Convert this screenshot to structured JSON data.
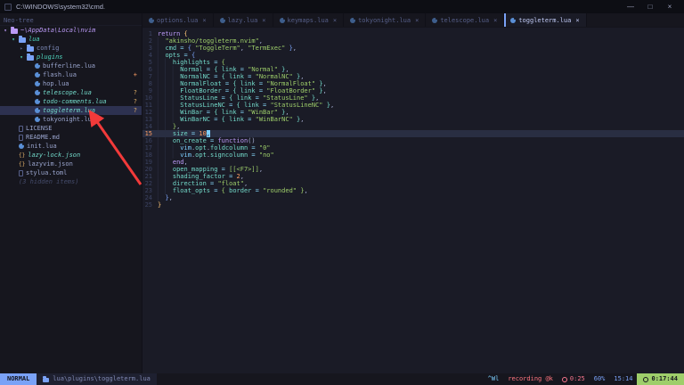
{
  "titlebar": {
    "title": "C:\\WINDOWS\\system32\\cmd.",
    "minimize": "—",
    "maximize": "□",
    "close": "×"
  },
  "sidebar": {
    "title": "Neo-tree",
    "items": [
      {
        "name": "~\\AppData\\Local\\nvim",
        "depth": 0,
        "kind": "root",
        "chevron": "▾"
      },
      {
        "name": "lua",
        "depth": 1,
        "kind": "dir-open",
        "chevron": "▾"
      },
      {
        "name": "config",
        "depth": 2,
        "kind": "dir",
        "chevron": "▸"
      },
      {
        "name": "plugins",
        "depth": 2,
        "kind": "dir-open",
        "chevron": "▾"
      },
      {
        "name": "bufferline.lua",
        "depth": 3,
        "kind": "lua-file"
      },
      {
        "name": "flash.lua",
        "depth": 3,
        "kind": "lua-file",
        "badge": "+",
        "badge_kind": "mod"
      },
      {
        "name": "hop.lua",
        "depth": 3,
        "kind": "lua-file"
      },
      {
        "name": "telescope.lua",
        "depth": 3,
        "kind": "lua-file untracked",
        "badge": "?",
        "badge_kind": "untracked"
      },
      {
        "name": "todo-comments.lua",
        "depth": 3,
        "kind": "lua-file untracked",
        "badge": "?",
        "badge_kind": "untracked"
      },
      {
        "name": "toggleterm.lua",
        "depth": 3,
        "kind": "lua-file untracked selected",
        "badge": "?",
        "badge_kind": "untracked"
      },
      {
        "name": "tokyonight.lua",
        "depth": 3,
        "kind": "lua-file"
      },
      {
        "name": "LICENSE",
        "depth": 1,
        "kind": "doc-file"
      },
      {
        "name": "README.md",
        "depth": 1,
        "kind": "doc-file"
      },
      {
        "name": "init.lua",
        "depth": 1,
        "kind": "lua-file"
      },
      {
        "name": "lazy-lock.json",
        "depth": 1,
        "kind": "json-file untracked"
      },
      {
        "name": "lazyvim.json",
        "depth": 1,
        "kind": "json-file"
      },
      {
        "name": "stylua.toml",
        "depth": 1,
        "kind": "doc-file"
      },
      {
        "name": "(3 hidden items)",
        "depth": 1,
        "kind": "hidden-note"
      }
    ]
  },
  "tabbar": {
    "close_glyph": "×",
    "tabs": [
      {
        "label": "options.lua",
        "active": false
      },
      {
        "label": "lazy.lua",
        "active": false
      },
      {
        "label": "keymaps.lua",
        "active": false
      },
      {
        "label": "tokyonight.lua",
        "active": false
      },
      {
        "label": "telescope.lua",
        "active": false
      },
      {
        "label": "toggleterm.lua",
        "active": true
      }
    ]
  },
  "editor": {
    "lines": [
      {
        "n": 1,
        "tokens": [
          [
            "k",
            "return"
          ],
          [
            "p",
            " "
          ],
          [
            "b1",
            "{"
          ]
        ]
      },
      {
        "n": 2,
        "tokens": [
          [
            "g",
            "▏ "
          ],
          [
            "s",
            "\"akinsho/toggleterm.nvim\""
          ],
          [
            "p",
            ","
          ]
        ]
      },
      {
        "n": 3,
        "tokens": [
          [
            "g",
            "▏ "
          ],
          [
            "f",
            "cmd"
          ],
          [
            "o",
            " = "
          ],
          [
            "b2",
            "{"
          ],
          [
            "p",
            " "
          ],
          [
            "s",
            "\"ToggleTerm\""
          ],
          [
            "p",
            ", "
          ],
          [
            "s",
            "\"TermExec\""
          ],
          [
            "p",
            " "
          ],
          [
            "b2",
            "}"
          ],
          [
            "p",
            ","
          ]
        ]
      },
      {
        "n": 4,
        "tokens": [
          [
            "g",
            "▏ "
          ],
          [
            "f",
            "opts"
          ],
          [
            "o",
            " = "
          ],
          [
            "b2",
            "{"
          ]
        ]
      },
      {
        "n": 5,
        "tokens": [
          [
            "g",
            "▏ ▏ "
          ],
          [
            "f",
            "highlights"
          ],
          [
            "o",
            " = "
          ],
          [
            "b3",
            "{"
          ]
        ]
      },
      {
        "n": 6,
        "tokens": [
          [
            "g",
            "▏ ▏ ▏ "
          ],
          [
            "f",
            "Normal"
          ],
          [
            "o",
            " = "
          ],
          [
            "b4",
            "{"
          ],
          [
            "p",
            " "
          ],
          [
            "f",
            "link"
          ],
          [
            "o",
            " = "
          ],
          [
            "s",
            "\"Normal\""
          ],
          [
            "p",
            " "
          ],
          [
            "b4",
            "}"
          ],
          [
            "p",
            ","
          ]
        ]
      },
      {
        "n": 7,
        "tokens": [
          [
            "g",
            "▏ ▏ ▏ "
          ],
          [
            "f",
            "NormalNC"
          ],
          [
            "o",
            " = "
          ],
          [
            "b4",
            "{"
          ],
          [
            "p",
            " "
          ],
          [
            "f",
            "link"
          ],
          [
            "o",
            " = "
          ],
          [
            "s",
            "\"NormalNC\""
          ],
          [
            "p",
            " "
          ],
          [
            "b4",
            "}"
          ],
          [
            "p",
            ","
          ]
        ]
      },
      {
        "n": 8,
        "tokens": [
          [
            "g",
            "▏ ▏ ▏ "
          ],
          [
            "f",
            "NormalFloat"
          ],
          [
            "o",
            " = "
          ],
          [
            "b4",
            "{"
          ],
          [
            "p",
            " "
          ],
          [
            "f",
            "link"
          ],
          [
            "o",
            " = "
          ],
          [
            "s",
            "\"NormalFloat\""
          ],
          [
            "p",
            " "
          ],
          [
            "b4",
            "}"
          ],
          [
            "p",
            ","
          ]
        ]
      },
      {
        "n": 9,
        "tokens": [
          [
            "g",
            "▏ ▏ ▏ "
          ],
          [
            "f",
            "FloatBorder"
          ],
          [
            "o",
            " = "
          ],
          [
            "b4",
            "{"
          ],
          [
            "p",
            " "
          ],
          [
            "f",
            "link"
          ],
          [
            "o",
            " = "
          ],
          [
            "s",
            "\"FloatBorder\""
          ],
          [
            "p",
            " "
          ],
          [
            "b4",
            "}"
          ],
          [
            "p",
            ","
          ]
        ]
      },
      {
        "n": 10,
        "tokens": [
          [
            "g",
            "▏ ▏ ▏ "
          ],
          [
            "f",
            "StatusLine"
          ],
          [
            "o",
            " = "
          ],
          [
            "b4",
            "{"
          ],
          [
            "p",
            " "
          ],
          [
            "f",
            "link"
          ],
          [
            "o",
            " = "
          ],
          [
            "s",
            "\"StatusLine\""
          ],
          [
            "p",
            " "
          ],
          [
            "b4",
            "}"
          ],
          [
            "p",
            ","
          ]
        ]
      },
      {
        "n": 11,
        "tokens": [
          [
            "g",
            "▏ ▏ ▏ "
          ],
          [
            "f",
            "StatusLineNC"
          ],
          [
            "o",
            " = "
          ],
          [
            "b4",
            "{"
          ],
          [
            "p",
            " "
          ],
          [
            "f",
            "link"
          ],
          [
            "o",
            " = "
          ],
          [
            "s",
            "\"StatusLineNC\""
          ],
          [
            "p",
            " "
          ],
          [
            "b4",
            "}"
          ],
          [
            "p",
            ","
          ]
        ]
      },
      {
        "n": 12,
        "tokens": [
          [
            "g",
            "▏ ▏ ▏ "
          ],
          [
            "f",
            "WinBar"
          ],
          [
            "o",
            " = "
          ],
          [
            "b4",
            "{"
          ],
          [
            "p",
            " "
          ],
          [
            "f",
            "link"
          ],
          [
            "o",
            " = "
          ],
          [
            "s",
            "\"WinBar\""
          ],
          [
            "p",
            " "
          ],
          [
            "b4",
            "}"
          ],
          [
            "p",
            ","
          ]
        ]
      },
      {
        "n": 13,
        "tokens": [
          [
            "g",
            "▏ ▏ ▏ "
          ],
          [
            "f",
            "WinBarNC"
          ],
          [
            "o",
            " = "
          ],
          [
            "b4",
            "{"
          ],
          [
            "p",
            " "
          ],
          [
            "f",
            "link"
          ],
          [
            "o",
            " = "
          ],
          [
            "s",
            "\"WinBarNC\""
          ],
          [
            "p",
            " "
          ],
          [
            "b4",
            "}"
          ],
          [
            "p",
            ","
          ]
        ]
      },
      {
        "n": 14,
        "tokens": [
          [
            "g",
            "▏ ▏ "
          ],
          [
            "b3",
            "}"
          ],
          [
            "p",
            ","
          ]
        ]
      },
      {
        "n": 15,
        "current": true,
        "tokens": [
          [
            "g",
            "▏ ▏ "
          ],
          [
            "f",
            "size"
          ],
          [
            "o",
            " = "
          ],
          [
            "n",
            "10"
          ],
          [
            "cur",
            ","
          ]
        ]
      },
      {
        "n": 16,
        "tokens": [
          [
            "g",
            "▏ ▏ "
          ],
          [
            "f",
            "on_create"
          ],
          [
            "o",
            " = "
          ],
          [
            "k",
            "function"
          ],
          [
            "p",
            "()"
          ]
        ]
      },
      {
        "n": 17,
        "tokens": [
          [
            "g",
            "▏ ▏ ▏ "
          ],
          [
            "v",
            "vim"
          ],
          [
            "p",
            "."
          ],
          [
            "f",
            "opt"
          ],
          [
            "p",
            "."
          ],
          [
            "f",
            "foldcolumn"
          ],
          [
            "o",
            " = "
          ],
          [
            "s",
            "\"0\""
          ]
        ]
      },
      {
        "n": 18,
        "tokens": [
          [
            "g",
            "▏ ▏ ▏ "
          ],
          [
            "v",
            "vim"
          ],
          [
            "p",
            "."
          ],
          [
            "f",
            "opt"
          ],
          [
            "p",
            "."
          ],
          [
            "f",
            "signcolumn"
          ],
          [
            "o",
            " = "
          ],
          [
            "s",
            "\"no\""
          ]
        ]
      },
      {
        "n": 19,
        "tokens": [
          [
            "g",
            "▏ ▏ "
          ],
          [
            "k",
            "end"
          ],
          [
            "p",
            ","
          ]
        ]
      },
      {
        "n": 20,
        "tokens": [
          [
            "g",
            "▏ ▏ "
          ],
          [
            "f",
            "open_mapping"
          ],
          [
            "o",
            " = "
          ],
          [
            "s",
            "[[<F7>]]"
          ],
          [
            "p",
            ","
          ]
        ]
      },
      {
        "n": 21,
        "tokens": [
          [
            "g",
            "▏ ▏ "
          ],
          [
            "f",
            "shading_factor"
          ],
          [
            "o",
            " = "
          ],
          [
            "n",
            "2"
          ],
          [
            "p",
            ","
          ]
        ]
      },
      {
        "n": 22,
        "tokens": [
          [
            "g",
            "▏ ▏ "
          ],
          [
            "f",
            "direction"
          ],
          [
            "o",
            " = "
          ],
          [
            "s",
            "\"float\""
          ],
          [
            "p",
            ","
          ]
        ]
      },
      {
        "n": 23,
        "tokens": [
          [
            "g",
            "▏ ▏ "
          ],
          [
            "f",
            "float_opts"
          ],
          [
            "o",
            " = "
          ],
          [
            "b3",
            "{"
          ],
          [
            "p",
            " "
          ],
          [
            "f",
            "border"
          ],
          [
            "o",
            " = "
          ],
          [
            "s",
            "\"rounded\""
          ],
          [
            "p",
            " "
          ],
          [
            "b3",
            "}"
          ],
          [
            "p",
            ","
          ]
        ]
      },
      {
        "n": 24,
        "tokens": [
          [
            "g",
            "▏ "
          ],
          [
            "b2",
            "}"
          ],
          [
            "p",
            ","
          ]
        ]
      },
      {
        "n": 25,
        "tokens": [
          [
            "b1",
            "}"
          ]
        ]
      }
    ]
  },
  "statusline": {
    "mode": "NORMAL",
    "path": "lua\\plugins\\toggleterm.lua",
    "right": [
      {
        "text": "^Wl",
        "kind": "keys"
      },
      {
        "text": "recording @k",
        "kind": "recording"
      },
      {
        "text": "0:25",
        "kind": "timer"
      },
      {
        "text": "60%",
        "kind": "percent"
      },
      {
        "text": "15:14",
        "kind": "position"
      },
      {
        "text": "0:17:44",
        "kind": "clock"
      }
    ]
  },
  "annotation": {
    "arrow_color": "#f23a3a"
  }
}
